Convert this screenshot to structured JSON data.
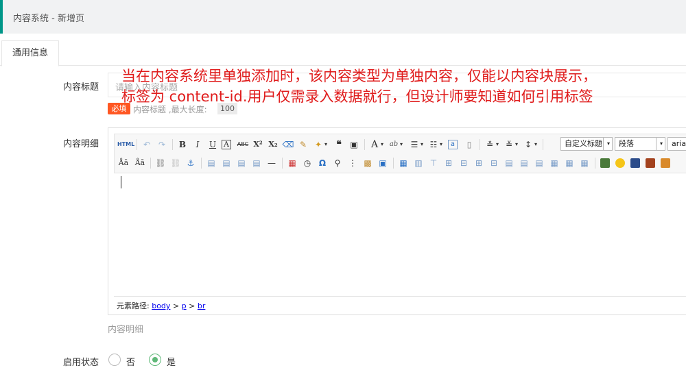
{
  "header": {
    "title": "内容系统 - 新增页"
  },
  "tabs": [
    {
      "label": "通用信息"
    }
  ],
  "form": {
    "title_label": "内容标题",
    "title_placeholder": "请输入内容标题",
    "required_badge": "必填",
    "title_hint": "内容标题 ,最大长度:",
    "max_length": "100",
    "detail_label": "内容明细",
    "detail_help": "内容明细",
    "status_label": "启用状态",
    "status_options": [
      {
        "label": "否",
        "selected": false
      },
      {
        "label": "是",
        "selected": true
      }
    ]
  },
  "annotation": {
    "line1": "当在内容系统里单独添加时，该内容类型为单独内容，仅能以内容块展示，",
    "line2": "标签为 content-id.用户仅需录入数据就行，但设计师要知道如何引用标签"
  },
  "editor": {
    "toolbar": {
      "html_label": "HTML",
      "custom_heading": "自定义标题",
      "paragraph": "段落",
      "font": "arial"
    },
    "statusbar": {
      "prefix": "元素路径:",
      "path": [
        "body",
        "p",
        "br"
      ],
      "separator": ">"
    }
  },
  "colors": {
    "accent": "#009688",
    "required": "#ff5722",
    "annotation": "#e01b1b",
    "radio_on": "#5fb878"
  }
}
